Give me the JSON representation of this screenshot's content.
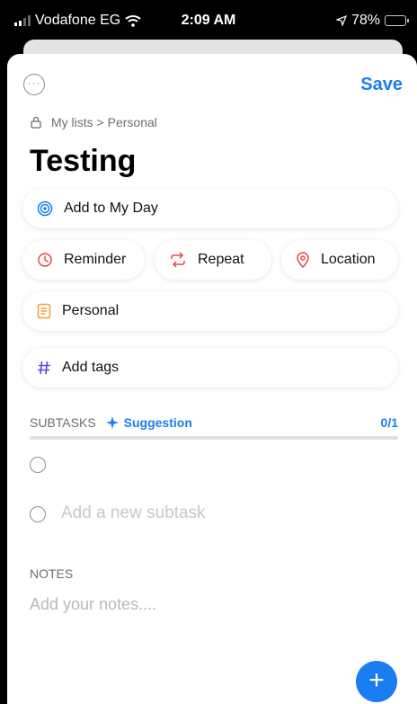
{
  "status_bar": {
    "carrier": "Vodafone EG",
    "time": "2:09 AM",
    "battery": "78%",
    "battery_level": 0.78
  },
  "toolbar": {
    "save_label": "Save",
    "more_glyph": "···"
  },
  "breadcrumb": "My lists > Personal",
  "task_title": "Testing",
  "actions": {
    "my_day": "Add to My Day",
    "reminder": "Reminder",
    "repeat": "Repeat",
    "location": "Location",
    "list": "Personal",
    "tags": "Add tags"
  },
  "subtasks": {
    "label": "SUBTASKS",
    "suggestion": "Suggestion",
    "count": "0/1",
    "add_placeholder": "Add a new subtask"
  },
  "notes": {
    "label": "NOTES",
    "placeholder": "Add your notes...."
  },
  "fab_glyph": "+",
  "colors": {
    "accent": "#1a7ef0",
    "reminder": "#e5484d",
    "location": "#e5484d",
    "list": "#f0a030",
    "tags": "#5b4ce0"
  },
  "icons": [
    "lock-icon",
    "target-icon",
    "clock-icon",
    "repeat-icon",
    "location-pin-icon",
    "list-icon",
    "hash-icon",
    "sparkle-icon",
    "plus-icon"
  ]
}
